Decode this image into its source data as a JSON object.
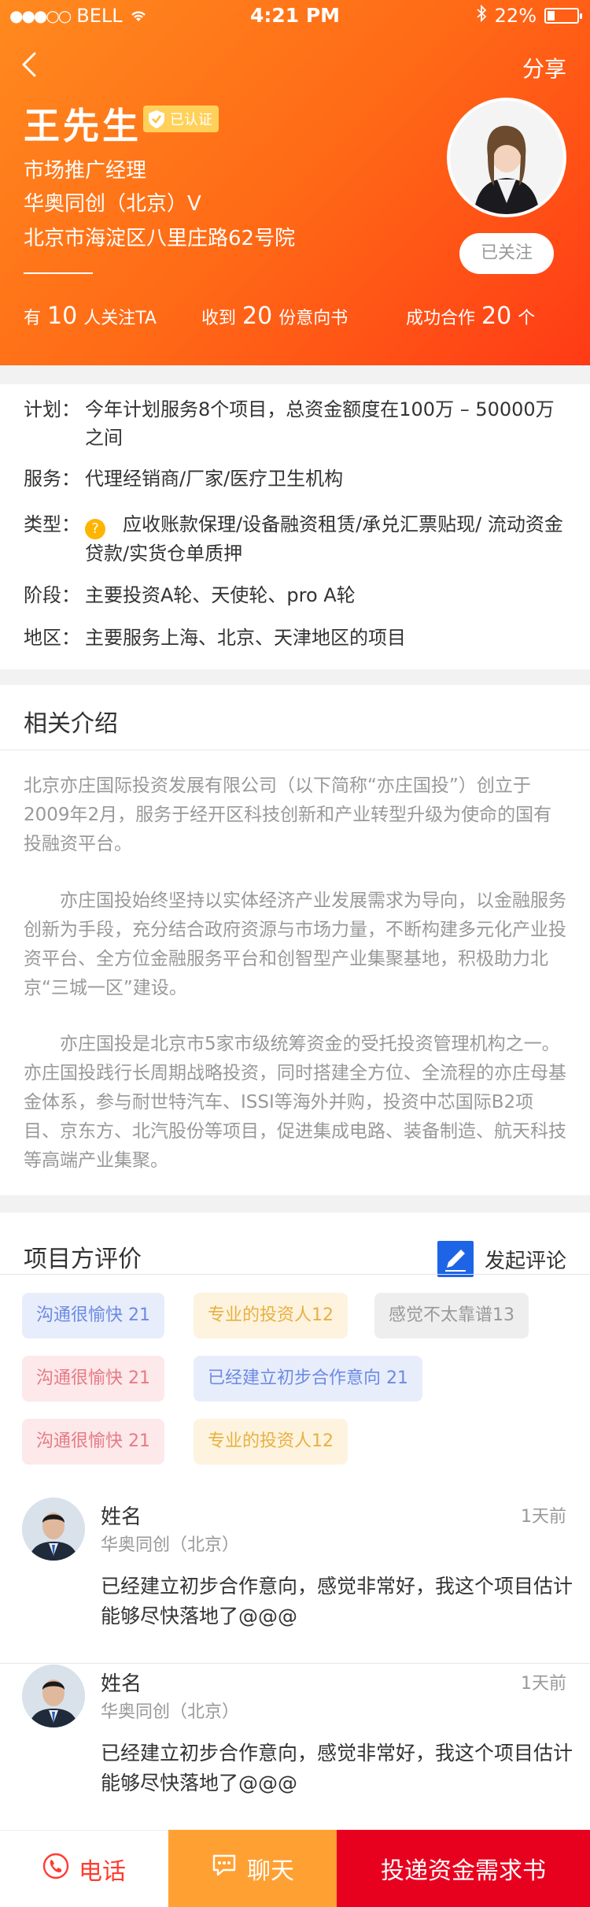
{
  "status_bar": {
    "carrier": "BELL",
    "signal": "●●●○○",
    "time": "4:21 PM",
    "battery": "22%"
  },
  "header": {
    "share_label": "分享",
    "name": "王先生",
    "verified_label": "已认证",
    "title": "市场推广经理",
    "company": "华奥同创（北京）V",
    "address": "北京市海淀区八里庄路62号院",
    "follow_label": "已关注",
    "stats": [
      {
        "prefix": "有",
        "num": "10",
        "suffix": "人关注TA"
      },
      {
        "prefix": "收到",
        "num": "20",
        "suffix": "份意向书"
      },
      {
        "prefix": "成功合作",
        "num": "20",
        "suffix": "个"
      }
    ]
  },
  "plan": {
    "rows": [
      {
        "key": "计划：",
        "value": "今年计划服务8个项目，总资金额度在100万 – 50000万之间"
      },
      {
        "key": "服务：",
        "value": "代理经销商/厂家/医疗卫生机构"
      },
      {
        "key": "类型：",
        "value": "应收账款保理/设备融资租赁/承兑汇票贴现/ 流动资金贷款/实货仓单质押"
      },
      {
        "key": "阶段：",
        "value": "主要投资A轮、天使轮、pro A轮"
      },
      {
        "key": "地区：",
        "value": "主要服务上海、北京、天津地区的项目"
      }
    ]
  },
  "intro": {
    "title": "相关介绍",
    "p1": "北京亦庄国际投资发展有限公司（以下简称“亦庄国投”）创立于2009年2月，服务于经开区科技创新和产业转型升级为使命的国有投融资平台。",
    "p2": "亦庄国投始终坚持以实体经济产业发展需求为导向，以金融服务创新为手段，充分结合政府资源与市场力量，不断构建多元化产业投资平台、全方位金融服务平台和创智型产业集聚基地，积极助力北京“三城一区”建设。",
    "p3": "亦庄国投是北京市5家市级统筹资金的受托投资管理机构之一。亦庄国投践行长周期战略投资，同时搭建全方位、全流程的亦庄母基金体系，参与耐世特汽车、ISSI等海外并购，投资中芯国际B2项目、京东方、北汽股份等项目，促进集成电路、装备制造、航天科技等高端产业集聚。"
  },
  "reviews": {
    "title": "项目方评价",
    "compose_label": "发起评论",
    "tags": [
      {
        "text": "沟通很愉快  21"
      },
      {
        "text": "专业的投资人12"
      },
      {
        "text": "感觉不太靠谱13"
      },
      {
        "text": "沟通很愉快  21"
      },
      {
        "text": "已经建立初步合作意向  21"
      },
      {
        "text": "沟通很愉快  21"
      },
      {
        "text": "专业的投资人12"
      }
    ],
    "comments": [
      {
        "name": "姓名",
        "org": "华奥同创（北京）",
        "time": "1天前",
        "body": "已经建立初步合作意向，感觉非常好，我这个项目估计能够尽快落地了@@@"
      },
      {
        "name": "姓名",
        "org": "华奥同创（北京）",
        "time": "1天前",
        "body": "已经建立初步合作意向，感觉非常好，我这个项目估计能够尽快落地了@@@"
      }
    ]
  },
  "bottom": {
    "phone_label": "电话",
    "chat_label": "聊天",
    "submit_label": "投递资金需求书"
  },
  "colors": {
    "accent": "#ff6a16",
    "submit": "#e8001f",
    "chat": "#ffa033",
    "compose": "#1e64e6"
  },
  "icons": [
    "back-arrow-icon",
    "wifi-icon",
    "bluetooth-icon",
    "battery-icon",
    "verified-shield-icon",
    "question-icon",
    "edit-icon",
    "phone-icon",
    "chat-icon"
  ]
}
